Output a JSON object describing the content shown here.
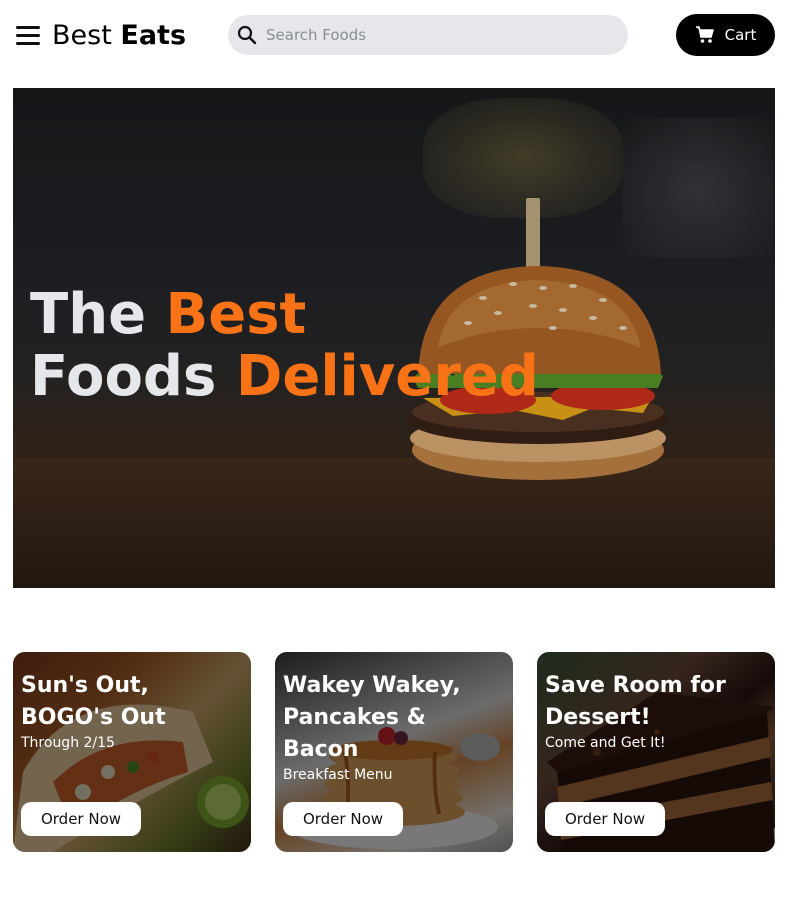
{
  "header": {
    "brand_regular": "Best",
    "brand_bold": "Eats",
    "search_placeholder": "Search Foods",
    "cart_label": "Cart"
  },
  "hero": {
    "line1_plain": "The",
    "line1_accent": "Best",
    "line2_plain": "Foods",
    "line2_accent": "Delivered"
  },
  "cards": [
    {
      "title": "Sun's Out, BOGO's Out",
      "subtitle": "Through 2/15",
      "button": "Order Now"
    },
    {
      "title": "Wakey Wakey, Pancakes & Bacon",
      "subtitle": "Breakfast Menu",
      "button": "Order Now"
    },
    {
      "title": "Save Room for Dessert!",
      "subtitle": "Come and Get It!",
      "button": "Order Now"
    }
  ],
  "colors": {
    "accent": "#f97316",
    "search_bg": "#e5e7eb",
    "cart_bg": "#000000",
    "hero_text": "#e5e7eb"
  },
  "icons": {
    "menu": "menu-icon",
    "search": "search-icon",
    "cart": "cart-icon"
  }
}
